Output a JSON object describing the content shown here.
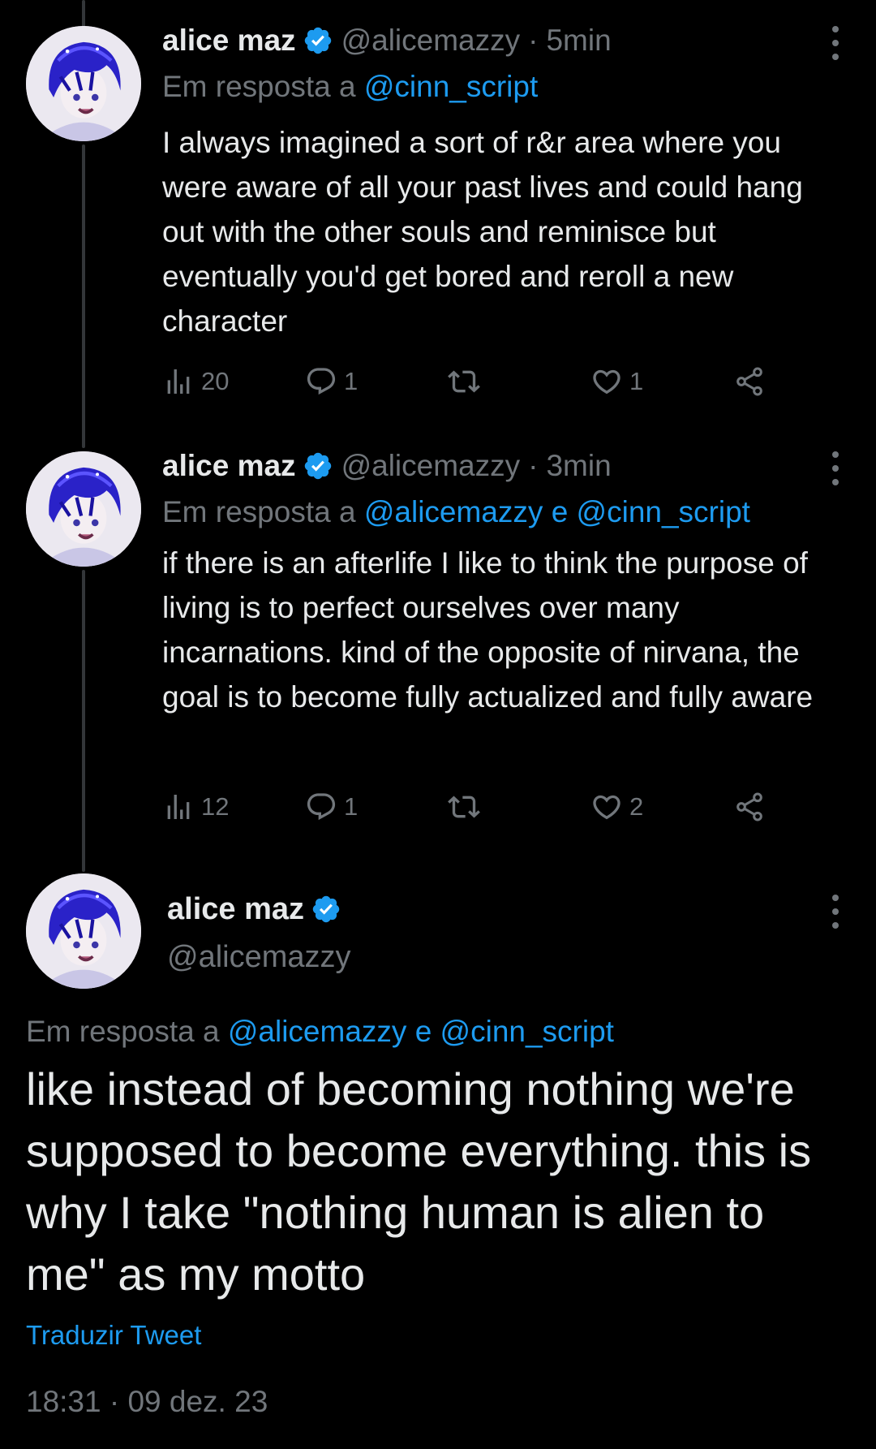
{
  "tweets": [
    {
      "name": "alice maz",
      "handle": "@alicemazzy",
      "sep": "·",
      "time": "5min",
      "reply_prefix": "Em resposta a",
      "reply_mentions": [
        "@cinn_script"
      ],
      "body": "I always imagined a sort of r&r area where you were aware of all your past lives and could hang out with the other souls and reminisce but eventually you'd get bored and reroll a new character",
      "stats": {
        "views": "20",
        "replies": "1",
        "retweets": "",
        "likes": "1"
      }
    },
    {
      "name": "alice maz",
      "handle": "@alicemazzy",
      "sep": "·",
      "time": "3min",
      "reply_prefix": "Em resposta a",
      "reply_mentions": [
        "@alicemazzy",
        "@cinn_script"
      ],
      "reply_joiner": "e",
      "body": "if there is an afterlife I like to think the purpose of living is to perfect ourselves over many incarnations. kind of the opposite of nirvana, the goal is to become fully actualized and fully aware",
      "stats": {
        "views": "12",
        "replies": "1",
        "retweets": "",
        "likes": "2"
      }
    }
  ],
  "main_tweet": {
    "name": "alice maz",
    "handle": "@alicemazzy",
    "reply_prefix": "Em resposta a",
    "reply_mentions": [
      "@alicemazzy",
      "@cinn_script"
    ],
    "reply_joiner": "e",
    "body": "like instead of becoming nothing we're supposed to become everything. this is why I take \"nothing human is alien to me\" as my motto",
    "translate_label": "Traduzir Tweet",
    "timestamp": "18:31 · 09 dez. 23"
  },
  "icons": {
    "verified": "verified-badge-icon",
    "more": "more-vertical-icon",
    "views": "views-chart-icon",
    "reply": "reply-bubble-icon",
    "retweet": "retweet-icon",
    "like": "heart-icon",
    "share": "share-icon"
  },
  "colors": {
    "background": "#000000",
    "text": "#e7e9ea",
    "secondary": "#71767b",
    "accent": "#1d9bf0",
    "thread_line": "#333639"
  }
}
